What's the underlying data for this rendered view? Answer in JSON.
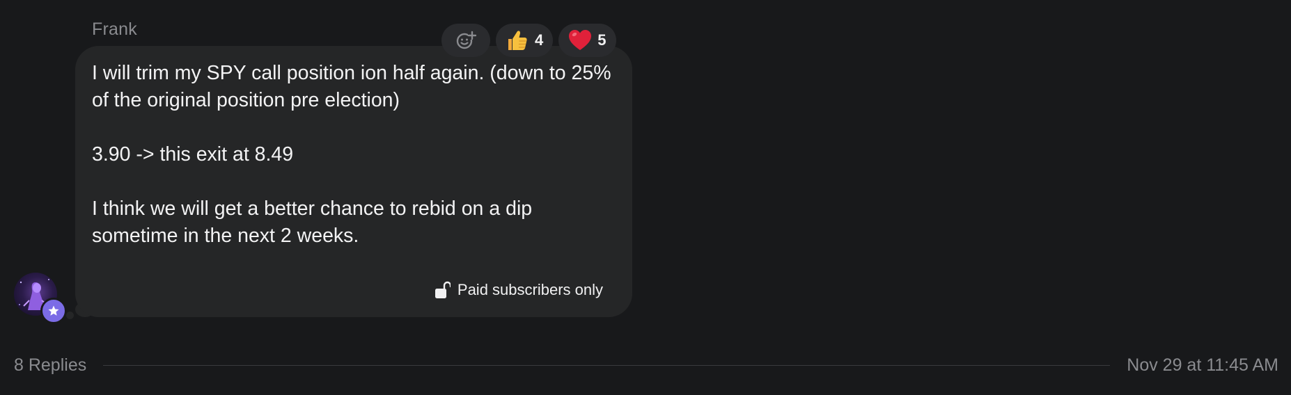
{
  "post": {
    "author": "Frank",
    "message_lines": [
      "I will trim my SPY call position ion half again. (down to 25% of the original position pre election)",
      "3.90 -> this exit at 8.49",
      "I think we will get a better chance to rebid on a dip sometime in the next 2 weeks."
    ],
    "access_label": "Paid subscribers only",
    "access_icon": "unlock-icon",
    "avatar_badge_icon": "star-icon"
  },
  "reactions": {
    "add_icon": "add-reaction-icon",
    "items": [
      {
        "emoji": "thumbs-up",
        "count": "4"
      },
      {
        "emoji": "heart",
        "count": "5"
      }
    ]
  },
  "footer": {
    "replies_label": "8 Replies",
    "timestamp": "Nov 29 at 11:45 AM"
  },
  "colors": {
    "background": "#18191b",
    "bubble": "#252627",
    "text_primary": "#f3f3f4",
    "text_muted": "#8a8b8f",
    "badge_accent": "#7b6ce6",
    "heart": "#e0213a",
    "thumbs_up": "#f7c03e"
  }
}
